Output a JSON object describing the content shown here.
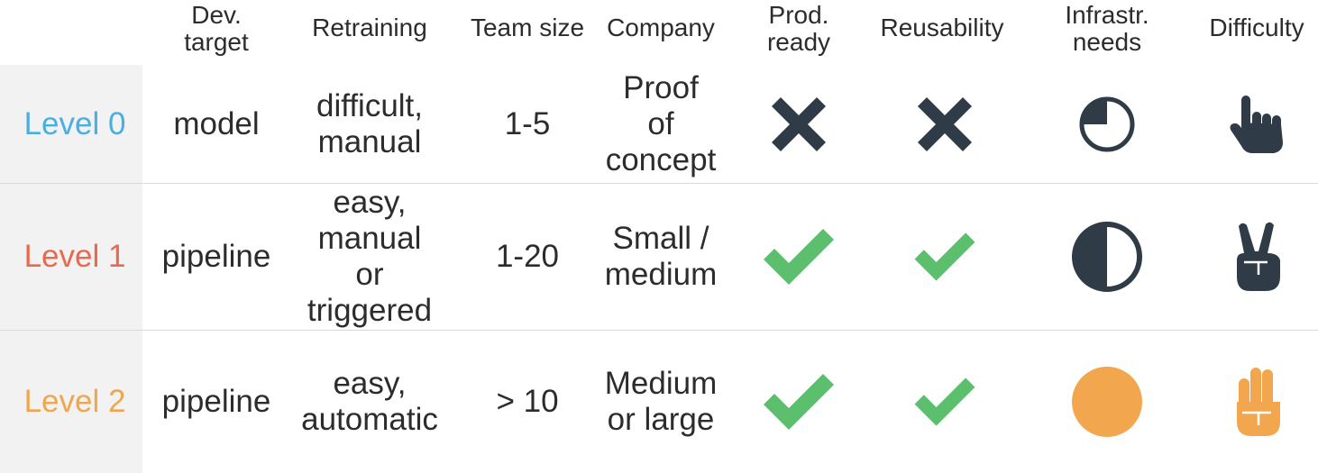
{
  "colors": {
    "level0": "#4aaee0",
    "level1": "#e8694e",
    "level2": "#f0a64e",
    "dark": "#2f3b47",
    "green": "#5bbf6d",
    "orange": "#f2a74e"
  },
  "headers": {
    "dev_target": "Dev.\ntarget",
    "retraining": "Retraining",
    "team_size": "Team size",
    "company": "Company",
    "prod_ready": "Prod.\nready",
    "reusability": "Reusability",
    "infra_needs": "Infrastr.\nneeds",
    "difficulty": "Difficulty"
  },
  "rows": [
    {
      "level": "Level 0",
      "dev_target": "model",
      "retraining": "difficult,\nmanual",
      "team_size": "1-5",
      "company": "Proof\nof\nconcept",
      "prod_ready_icon": "cross-icon",
      "reusability_icon": "cross-icon",
      "infra_icon": "quarter-circle-icon",
      "difficulty_icon": "one-finger-hand-icon"
    },
    {
      "level": "Level 1",
      "dev_target": "pipeline",
      "retraining": "easy,\nmanual\nor\ntriggered",
      "team_size": "1-20",
      "company": "Small /\nmedium",
      "prod_ready_icon": "check-icon",
      "reusability_icon": "check-icon",
      "infra_icon": "half-circle-icon",
      "difficulty_icon": "two-fingers-hand-icon"
    },
    {
      "level": "Level 2",
      "dev_target": "pipeline",
      "retraining": "easy,\nautomatic",
      "team_size": "> 10",
      "company": "Medium\nor large",
      "prod_ready_icon": "check-icon",
      "reusability_icon": "check-icon",
      "infra_icon": "full-circle-icon",
      "difficulty_icon": "three-fingers-hand-icon"
    }
  ]
}
